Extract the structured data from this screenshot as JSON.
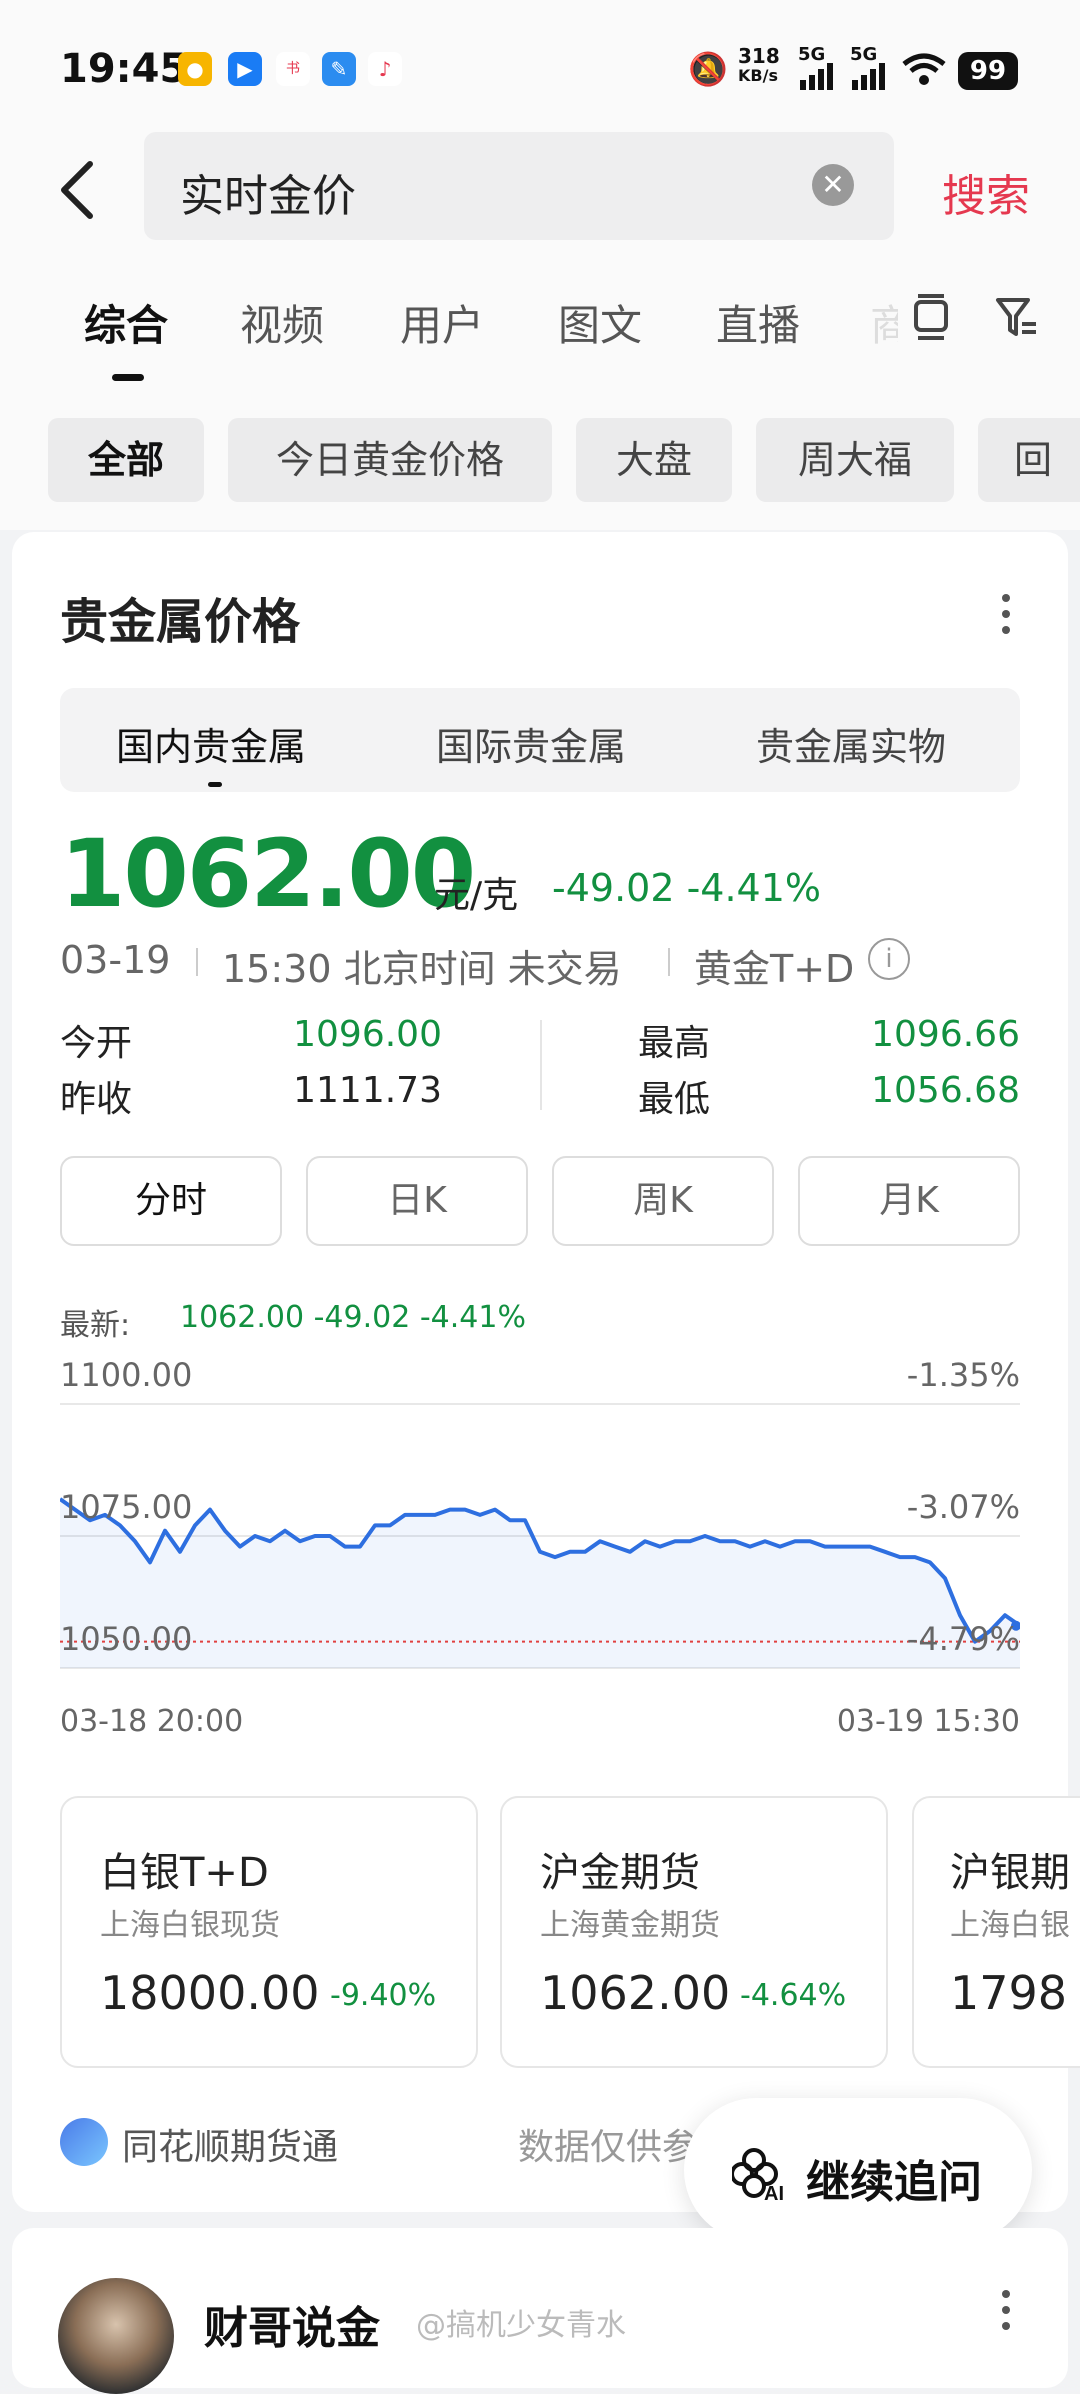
{
  "status_bar": {
    "time": "19:45",
    "net_speed_top": "318",
    "net_speed_bottom": "KB/s",
    "sig1": "5G",
    "sig2": "5G",
    "battery": "99"
  },
  "search": {
    "query": "实时金价",
    "button": "搜索"
  },
  "tabs": [
    "综合",
    "视频",
    "用户",
    "图文",
    "直播",
    "商"
  ],
  "chips": [
    "全部",
    "今日黄金价格",
    "大盘",
    "周大福",
    "回收"
  ],
  "card": {
    "title": "贵金属价格",
    "segments": [
      "国内贵金属",
      "国际贵金属",
      "贵金属实物"
    ],
    "price": "1062.00",
    "unit": "元/克",
    "change": "-49.02 -4.41%",
    "date": "03-19",
    "time_text": "15:30 北京时间 未交易",
    "instrument": "黄金T+D",
    "stats": {
      "open_label": "今开",
      "open_value": "1096.00",
      "prev_label": "昨收",
      "prev_value": "1111.73",
      "high_label": "最高",
      "high_value": "1096.66",
      "low_label": "最低",
      "low_value": "1056.68"
    },
    "k_buttons": [
      "分时",
      "日K",
      "周K",
      "月K"
    ],
    "latest_label": "最新:",
    "latest_value": "1062.00 -49.02 -4.41%"
  },
  "chart_data": {
    "type": "line",
    "x_start": "03-18 20:00",
    "x_end": "03-19 15:30",
    "y_left_ticks": [
      "1100.00",
      "1075.00",
      "1050.00"
    ],
    "y_right_ticks": [
      "-1.35%",
      "-3.07%",
      "-4.79%"
    ],
    "ylim": [
      1050,
      1100
    ],
    "reference_line": 1111.73,
    "series": [
      {
        "values": [
          1082,
          1080,
          1078,
          1079,
          1077,
          1074,
          1070,
          1076,
          1072,
          1077,
          1080,
          1076,
          1073,
          1075,
          1074,
          1076,
          1074,
          1075,
          1075,
          1073,
          1073,
          1077,
          1077,
          1079,
          1079,
          1079,
          1080,
          1080,
          1079,
          1080,
          1078,
          1078,
          1072,
          1071,
          1072,
          1072,
          1074,
          1073,
          1072,
          1074,
          1073,
          1074,
          1074,
          1075,
          1074,
          1074,
          1073,
          1074,
          1073,
          1074,
          1074,
          1073,
          1073,
          1073,
          1073,
          1072,
          1071,
          1071,
          1070,
          1067,
          1060,
          1055,
          1057,
          1060,
          1058
        ]
      }
    ]
  },
  "mini_cards": [
    {
      "title": "白银T+D",
      "sub": "上海白银现货",
      "price": "18000.00",
      "pct": "-9.40%"
    },
    {
      "title": "沪金期货",
      "sub": "上海黄金期货",
      "price": "1062.00",
      "pct": "-4.64%"
    },
    {
      "title": "沪银期",
      "sub": "上海白银",
      "price": "1798",
      "pct": ""
    }
  ],
  "source": "同花顺期货通",
  "disclaimer": "数据仅供参",
  "ai_button": "继续追问",
  "ai_badge": "AI",
  "next_post": {
    "author": "财哥说金",
    "watermark": "@搞机少女青水"
  },
  "colors": {
    "green": "#129040",
    "accent_red": "#e5384f",
    "line_blue": "#2e6fe0"
  }
}
